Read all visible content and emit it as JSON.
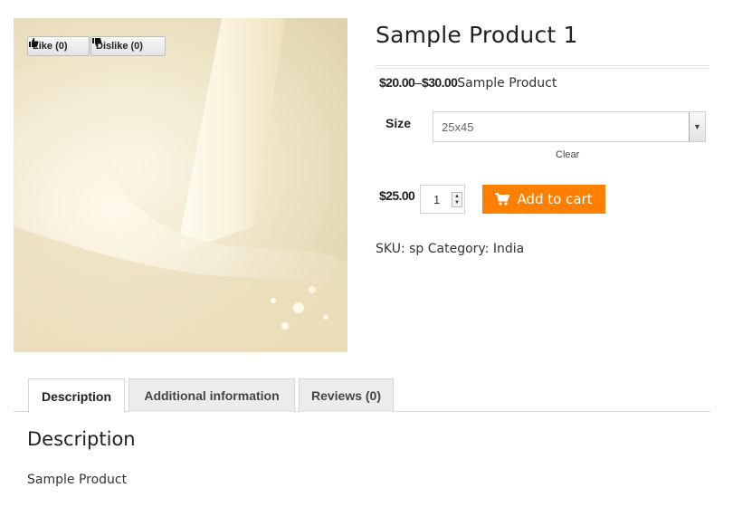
{
  "votes": {
    "like_label": "Like (0)",
    "dislike_label": "Dislike (0)"
  },
  "product": {
    "title": "Sample Product 1",
    "price_min": "$20.00",
    "price_separator": "–",
    "price_max": "$30.00",
    "short_description": "Sample Product",
    "size_label": "Size",
    "size_selected": "25x45",
    "clear_label": "Clear",
    "variation_price": "$25.00",
    "quantity": "1",
    "add_to_cart_label": "Add to cart",
    "sku_label": "SKU:",
    "sku_value": "sp",
    "category_label": "Category:",
    "category_value": "India"
  },
  "tabs": [
    {
      "label": "Description",
      "active": true
    },
    {
      "label": "Additional information",
      "active": false
    },
    {
      "label": "Reviews (0)",
      "active": false
    }
  ],
  "panel": {
    "heading": "Description",
    "text": "Sample Product"
  },
  "colors": {
    "accent": "#ff7f00",
    "tab_inactive": "#ececec"
  },
  "icons": {
    "like": "thumbs-up-icon",
    "dislike": "thumbs-down-icon",
    "cart": "cart-icon",
    "select_arrow": "chevron-down-icon"
  }
}
